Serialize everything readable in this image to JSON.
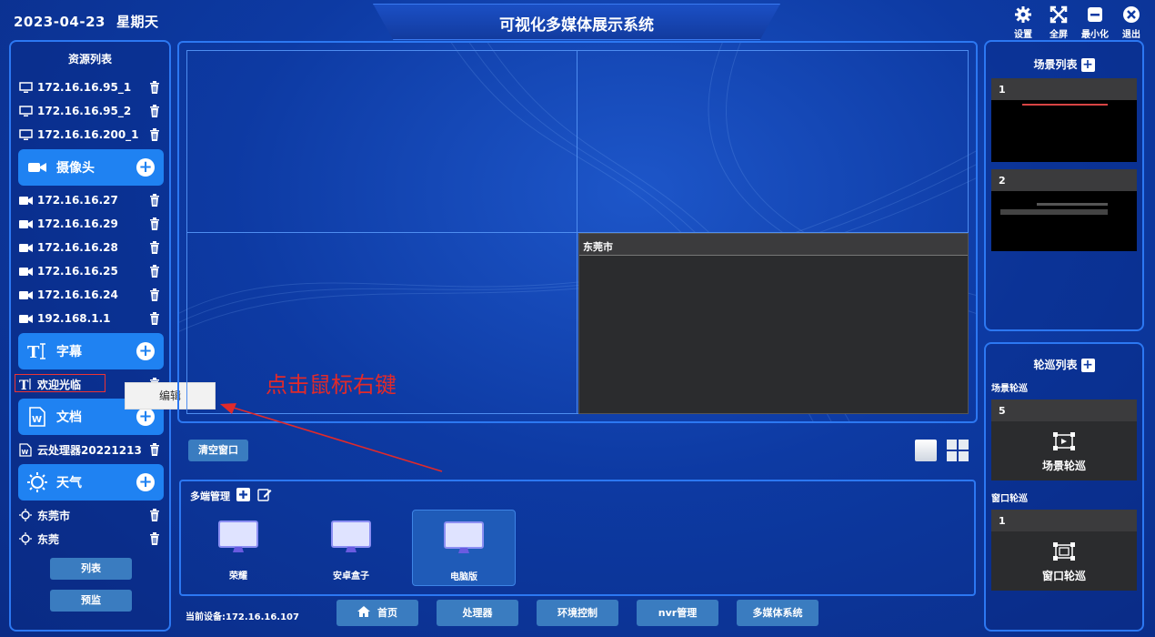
{
  "header": {
    "date": "2023-04-23",
    "weekday": "星期天",
    "title": "可视化多媒体展示系统",
    "buttons": [
      {
        "label": "设置",
        "icon": "gear-icon"
      },
      {
        "label": "全屏",
        "icon": "fullscreen-icon"
      },
      {
        "label": "最小化",
        "icon": "minimize-icon"
      },
      {
        "label": "退出",
        "icon": "close-icon"
      }
    ]
  },
  "resources": {
    "title": "资源列表",
    "screens": [
      "172.16.16.95_1",
      "172.16.16.95_2",
      "172.16.16.200_1"
    ],
    "camera_label": "摄像头",
    "cameras": [
      "172.16.16.27",
      "172.16.16.29",
      "172.16.16.28",
      "172.16.16.25",
      "172.16.16.24",
      "192.168.1.1"
    ],
    "subtitle_label": "字幕",
    "subtitles": [
      "欢迎光临"
    ],
    "doc_label": "文档",
    "docs": [
      "云处理器20221213"
    ],
    "weather_label": "天气",
    "weather": [
      "东莞市",
      "东莞"
    ],
    "list_button": "列表",
    "preview_button": "预监"
  },
  "context_menu": {
    "edit": "编辑"
  },
  "annotation": "点击鼠标右键",
  "canvas": {
    "window_title": "东莞市",
    "clear_button": "清空窗口"
  },
  "multi": {
    "title": "多端管理",
    "devices": [
      {
        "label": "荣耀",
        "selected": false
      },
      {
        "label": "安卓盒子",
        "selected": false
      },
      {
        "label": "电脑版",
        "selected": true
      }
    ]
  },
  "footer": {
    "current_device": "当前设备:172.16.16.107",
    "nav": [
      "首页",
      "处理器",
      "环境控制",
      "nvr管理",
      "多媒体系统"
    ]
  },
  "scenes": {
    "title": "场景列表",
    "items": [
      {
        "id": "1"
      },
      {
        "id": "2"
      }
    ]
  },
  "tours": {
    "title": "轮巡列表",
    "scene_sub": "场景轮巡",
    "scene_item": {
      "id": "5",
      "label": "场景轮巡"
    },
    "window_sub": "窗口轮巡",
    "window_item": {
      "id": "1",
      "label": "窗口轮巡"
    }
  },
  "colors": {
    "accent": "#1f82f2",
    "panel_border": "#2c78f2",
    "button": "#3a7cc0",
    "annotation": "#e12a2a"
  }
}
